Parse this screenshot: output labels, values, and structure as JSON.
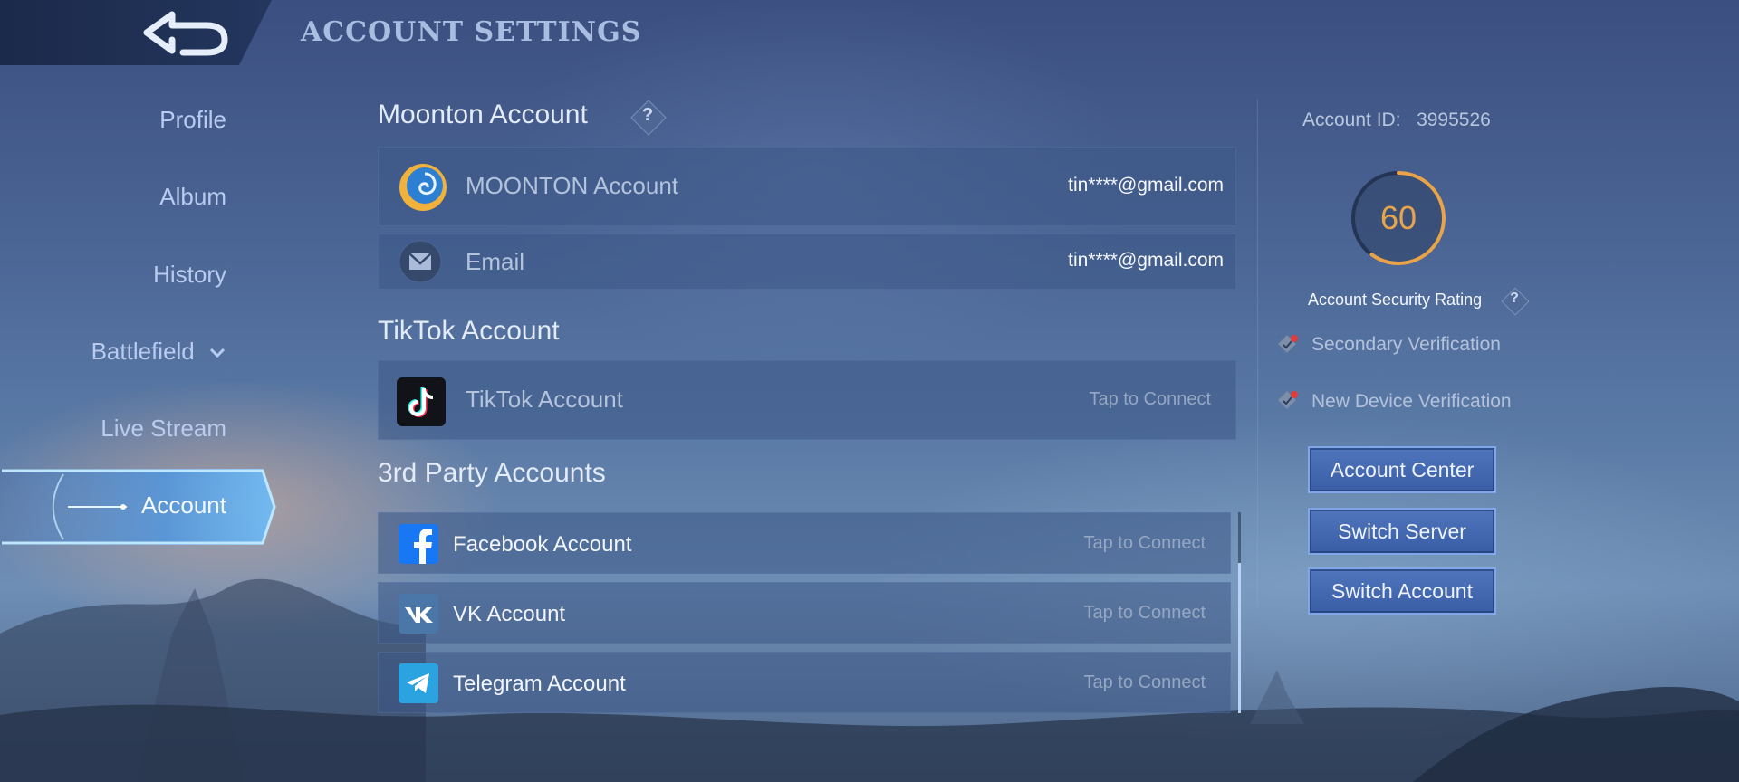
{
  "header": {
    "title": "ACCOUNT SETTINGS"
  },
  "nav": {
    "items": [
      {
        "label": "Profile"
      },
      {
        "label": "Album"
      },
      {
        "label": "History"
      },
      {
        "label": "Battlefield"
      },
      {
        "label": "Live Stream"
      },
      {
        "label": "Account"
      }
    ],
    "active": "Account"
  },
  "moonton": {
    "title": "Moonton Account",
    "rows": [
      {
        "label": "MOONTON Account",
        "value": "tin****@gmail.com",
        "icon": "moonton-logo-icon"
      },
      {
        "label": "Email",
        "value": "tin****@gmail.com",
        "icon": "envelope-icon"
      }
    ]
  },
  "tiktok": {
    "title": "TikTok Account",
    "row": {
      "label": "TikTok Account",
      "action": "Tap to Connect",
      "icon": "tiktok-icon"
    }
  },
  "third_party": {
    "title": "3rd Party Accounts",
    "rows": [
      {
        "label": "Facebook Account",
        "action": "Tap to Connect",
        "icon": "facebook-icon"
      },
      {
        "label": "VK Account",
        "action": "Tap to Connect",
        "icon": "vk-icon"
      },
      {
        "label": "Telegram Account",
        "action": "Tap to Connect",
        "icon": "telegram-icon"
      }
    ]
  },
  "security": {
    "account_id_label": "Account ID:",
    "account_id": "3995526",
    "rating": "60",
    "rating_fraction": 0.6,
    "rating_label": "Account Security Rating",
    "verifications": [
      {
        "label": "Secondary Verification"
      },
      {
        "label": "New Device Verification"
      }
    ]
  },
  "buttons": {
    "account_center": "Account Center",
    "switch_server": "Switch Server",
    "switch_account": "Switch Account"
  },
  "colors": {
    "accent_orange": "#e8a44a",
    "active_tab": "#5fb0f0",
    "button": "#3f64ad"
  }
}
